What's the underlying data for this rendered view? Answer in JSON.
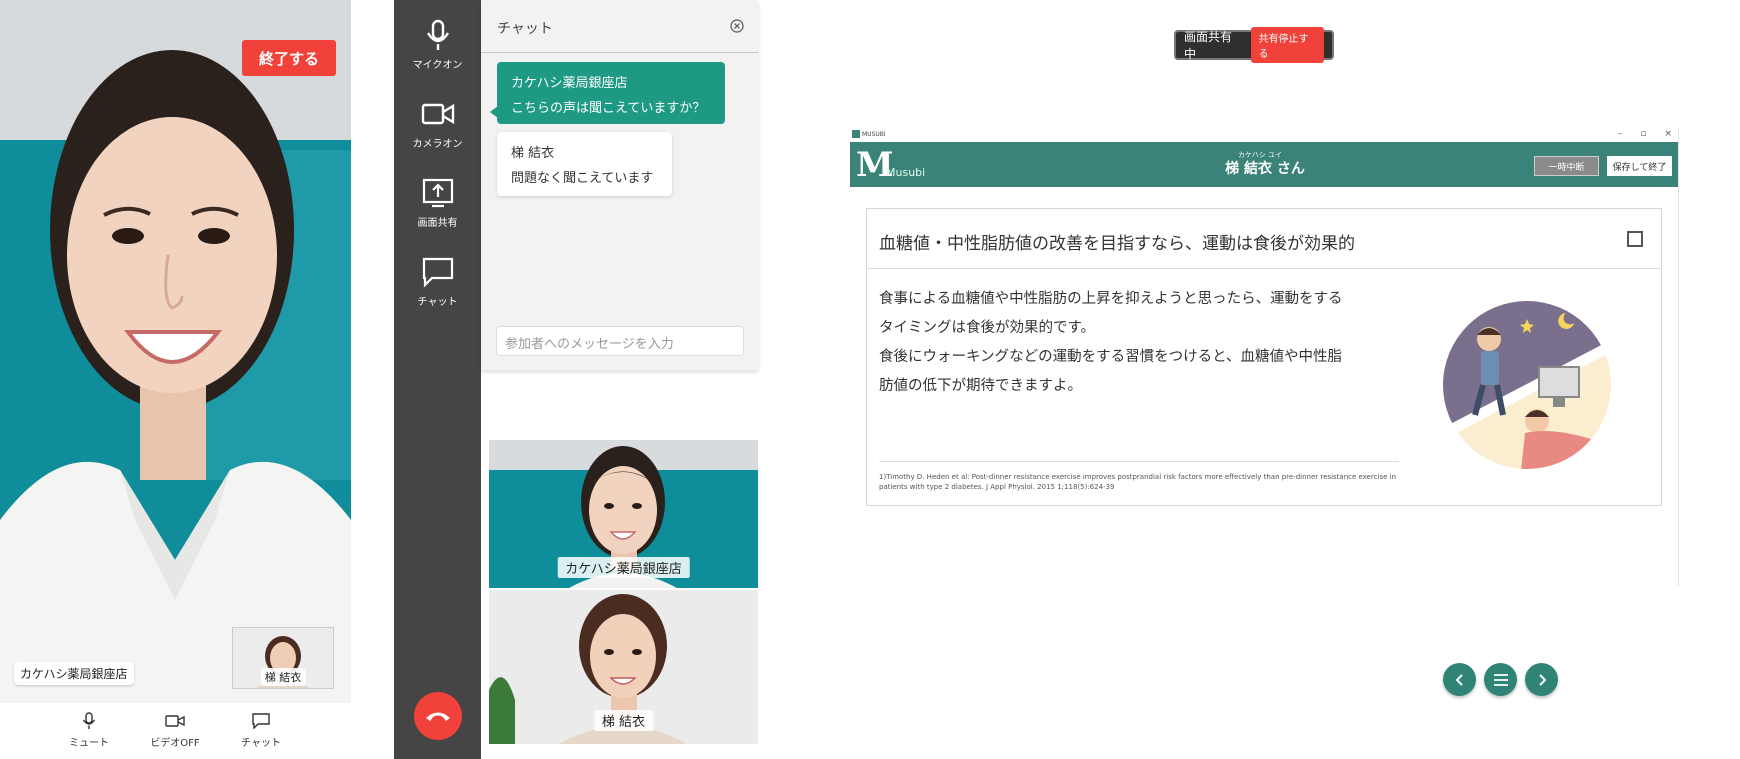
{
  "mobile": {
    "end_label": "終了する",
    "remote_name": "カケハシ薬局銀座店",
    "self_name": "梯 結衣",
    "controls": [
      {
        "label": "ミュート",
        "icon": "mic-icon"
      },
      {
        "label": "ビデオOFF",
        "icon": "video-icon"
      },
      {
        "label": "チャット",
        "icon": "chat-icon"
      }
    ]
  },
  "desktop": {
    "sidebar": [
      {
        "label": "マイクオン",
        "icon": "mic-icon"
      },
      {
        "label": "カメラオン",
        "icon": "camera-icon"
      },
      {
        "label": "画面共有",
        "icon": "screen-share-icon"
      },
      {
        "label": "チャット",
        "icon": "chat-icon"
      }
    ],
    "chat": {
      "title": "チャット",
      "messages": [
        {
          "sender": "カケハシ薬局銀座店",
          "text": "こちらの声は聞こえていますか？"
        },
        {
          "sender": "梯 結衣",
          "text": "問題なく聞こえています"
        }
      ],
      "input_placeholder": "参加者へのメッセージを入力"
    },
    "tiles": [
      {
        "label": "カケハシ薬局銀座店"
      },
      {
        "label": "梯 結衣"
      }
    ]
  },
  "share": {
    "status": "画面共有中",
    "stop_label": "共有停止する",
    "app": {
      "window_title": "MUSUBI",
      "logo_text": "Musubi",
      "patient_kana": "カケハシ ユイ",
      "patient_name": "梯 結衣 さん",
      "pause_label": "一時中断",
      "save_label": "保存して終了",
      "card": {
        "title": "血糖値・中性脂肪値の改善を目指すなら、運動は食後が効果的",
        "body": [
          "食事による血糖値や中性脂肪の上昇を抑えようと思ったら、運動をする",
          "タイミングは食後が効果的です。",
          "食後にウォーキングなどの運動をする習慣をつけると、血糖値や中性脂",
          "肪値の低下が期待できますよ。"
        ],
        "reference": [
          "1)Timothy D. Heden et al: Post-dinner resistance exercise improves postprandial risk factors more effectively than pre-dinner resistance exercise in",
          "patients with type 2 diabetes. J Appl Physiol. 2015 1;118(5):624-39"
        ]
      }
    }
  },
  "colors": {
    "red": "#f0413a",
    "teal": "#1e9a84",
    "musubi_green": "#3b8379",
    "sidebar_gray": "#454545"
  }
}
